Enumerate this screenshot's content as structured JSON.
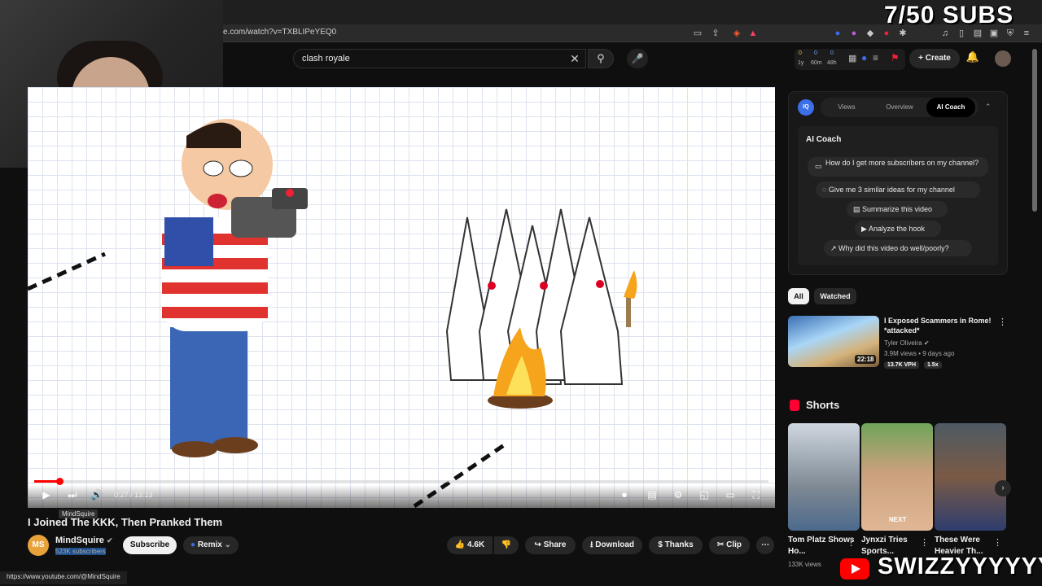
{
  "browser": {
    "url": "e.com/watch?v=TXBLIPeYEQ0"
  },
  "overlay": {
    "subs_counter": "7/50 SUBS",
    "brand_name": "SWIZZYYYYYY"
  },
  "header": {
    "search_value": "clash royale",
    "create_label": "Create",
    "stats": [
      "0",
      "0",
      "0",
      "1y",
      "60m",
      "48h"
    ]
  },
  "player": {
    "time": "0:27 / 13:13",
    "tooltip": "MindSquire",
    "progress_fraction": 0.034
  },
  "video": {
    "title": "I Joined The KKK, Then Pranked Them",
    "channel_name": "MindSquire",
    "channel_avatar_text": "MS",
    "subscribers": "523K subscribers",
    "subscribe_label": "Subscribe",
    "remix_label": "Remix",
    "likes": "4.6K",
    "share_label": "Share",
    "download_label": "Download",
    "thanks_label": "Thanks",
    "clip_label": "Clip"
  },
  "status_bar": {
    "url": "https://www.youtube.com/@MindSquire"
  },
  "ai_panel": {
    "badge": "IQ",
    "tabs": [
      "Views",
      "Overview",
      "AI Coach"
    ],
    "title": "AI Coach",
    "questions": [
      "How do I get more subscribers on my channel?",
      "Give me 3 similar ideas for my channel",
      "Summarize this video",
      "Analyze the hook",
      "Why did this video do well/poorly?"
    ]
  },
  "filters": {
    "chips": [
      "All",
      "Watched"
    ]
  },
  "recommended": {
    "title": "I Exposed Scammers in Rome! *attacked*",
    "channel": "Tyler Oliveira",
    "meta": "3.9M views • 9 days ago",
    "duration": "22:18",
    "vph": "13.7K VPH",
    "ratio": "1.5x"
  },
  "shorts": {
    "title": "Shorts",
    "items": [
      {
        "title": "Tom Platz Shows Ho...",
        "views": "133K views"
      },
      {
        "title": "Jynxzi Tries Sports...",
        "overlay_text": "NEXT"
      },
      {
        "title": "These Were Heavier Th..."
      }
    ]
  },
  "colors": {
    "accent": "#ff0000",
    "iq_blue": "#3c6ee8",
    "background": "#0f0f0f"
  }
}
